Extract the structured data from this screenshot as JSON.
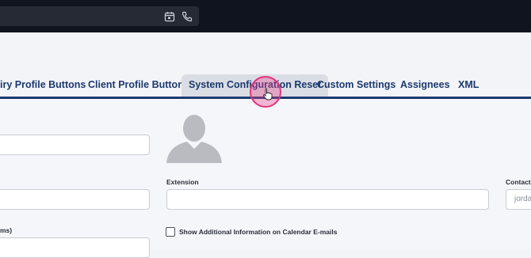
{
  "topbar": {
    "icons": [
      "calendar-icon",
      "phone-icon"
    ]
  },
  "tabs": [
    {
      "label": "iry Profile Buttons",
      "active": false
    },
    {
      "label": "Client Profile Buttons",
      "active": false
    },
    {
      "label": "System Configuration Reset",
      "active": true
    },
    {
      "label": "Custom Settings",
      "active": false
    },
    {
      "label": "Assignees",
      "active": false
    },
    {
      "label": "XML",
      "active": false
    }
  ],
  "form": {
    "extension_label": "Extension",
    "contact_label": "Contact I",
    "contact_placeholder": "jorda",
    "partial_label": "ms)",
    "checkbox_label": "Show Additional Information on Calendar E-mails",
    "checkbox_checked": false
  },
  "colors": {
    "accent": "#1b3a6e",
    "topbar": "#10141e",
    "cursor": "#e0357f"
  }
}
